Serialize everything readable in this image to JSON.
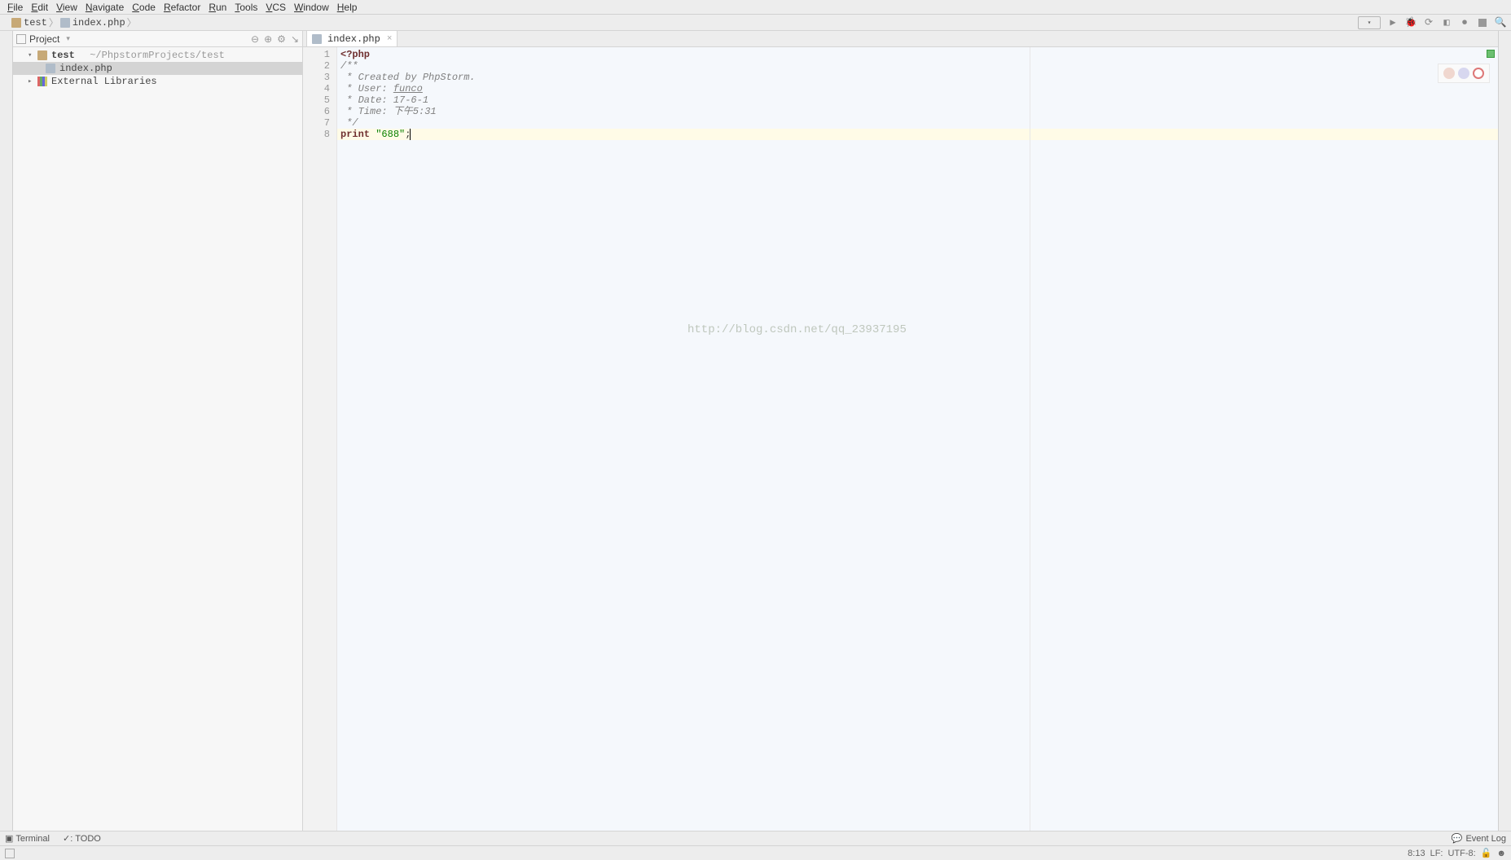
{
  "menu": [
    "File",
    "Edit",
    "View",
    "Navigate",
    "Code",
    "Refactor",
    "Run",
    "Tools",
    "VCS",
    "Window",
    "Help"
  ],
  "breadcrumb": {
    "project": "test",
    "file": "index.php"
  },
  "project_panel": {
    "title": "Project",
    "root": {
      "name": "test",
      "path": "~/PhpstormProjects/test"
    },
    "file": "index.php",
    "libraries": "External Libraries"
  },
  "editor": {
    "tab_name": "index.php",
    "lines": {
      "l1_php": "<?php",
      "l2": "/**",
      "l3": " * Created by PhpStorm.",
      "l4_pre": " * User: ",
      "l4_user": "funco",
      "l5": " * Date: 17-6-1",
      "l6": " * Time: 下午5:31",
      "l7": " */",
      "l8_print": "print ",
      "l8_str": "\"688\"",
      "l8_end": ";"
    }
  },
  "watermark": "http://blog.csdn.net/qq_23937195",
  "bottom": {
    "terminal": "Terminal",
    "todo": "TODO",
    "eventlog": "Event Log"
  },
  "status": {
    "pos": "8:13",
    "le": "LF:",
    "enc": "UTF-8:"
  }
}
